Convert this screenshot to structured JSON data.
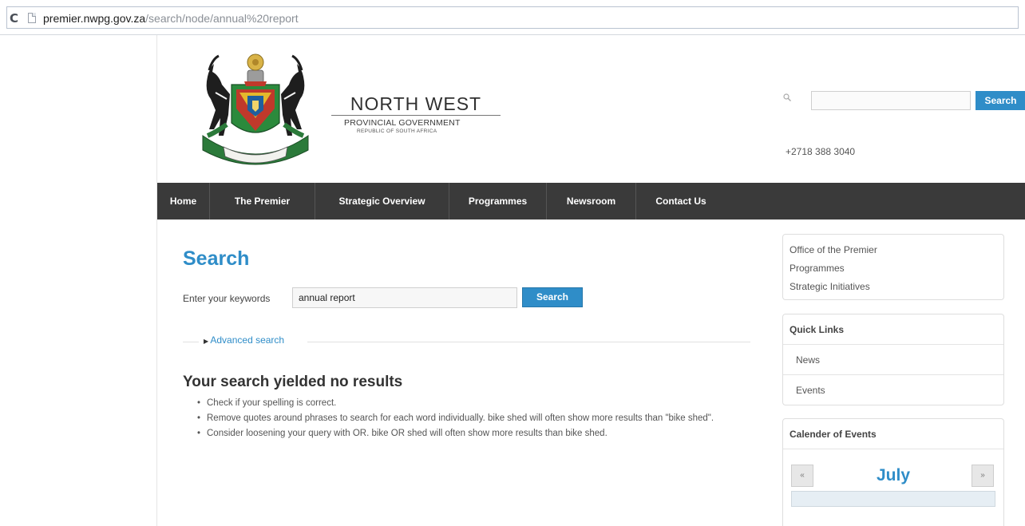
{
  "browser": {
    "url_host": "premier.nwpg.gov.za",
    "url_path": "/search/node/annual%20report"
  },
  "header": {
    "brand_name": "NORTH WEST",
    "brand_sub1": "PROVINCIAL GOVERNMENT",
    "brand_sub2": "REPUBLIC OF SOUTH AFRICA",
    "search_button": "Search",
    "search_placeholder": "",
    "phone": "+2718 388 3040"
  },
  "nav": {
    "items": [
      {
        "label": "Home"
      },
      {
        "label": "The Premier"
      },
      {
        "label": "Strategic Overview"
      },
      {
        "label": "Programmes"
      },
      {
        "label": "Newsroom"
      },
      {
        "label": "Contact Us"
      }
    ]
  },
  "main": {
    "title": "Search",
    "keywords_label": "Enter your keywords",
    "keywords_value": "annual report",
    "search_button": "Search",
    "advanced_search": "Advanced search",
    "no_results_title": "Your search yielded no results",
    "tips": [
      "Check if your spelling is correct.",
      "Remove quotes around phrases to search for each word individually. bike shed will often show more results than \"bike shed\".",
      "Consider loosening your query with OR. bike OR shed will often show more results than bike shed."
    ]
  },
  "sidebar": {
    "links": [
      "Office of the Premier",
      "Programmes",
      "Strategic Initiatives"
    ],
    "quick_links_title": "Quick Links",
    "quick_links": [
      "News",
      "Events"
    ],
    "calendar_title": "Calender of Events",
    "calendar_month": "July",
    "calendar_prev": "«",
    "calendar_next": "»"
  },
  "colors": {
    "accent": "#2f8dc8",
    "nav_bg": "#3a3a3a"
  }
}
